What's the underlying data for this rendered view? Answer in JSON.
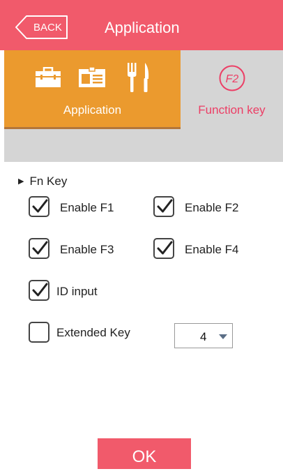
{
  "header": {
    "back_label": "BACK",
    "title": "Application"
  },
  "tabs": [
    {
      "label": "Application",
      "icons": [
        "briefcase-icon",
        "id-card-icon",
        "fork-knife-icon"
      ],
      "active": true
    },
    {
      "label": "Function key",
      "icon_text": "F2",
      "active": false
    }
  ],
  "section": {
    "title": "Fn Key"
  },
  "options": [
    {
      "label": "Enable F1",
      "checked": true
    },
    {
      "label": "Enable F2",
      "checked": true
    },
    {
      "label": "Enable F3",
      "checked": true
    },
    {
      "label": "Enable F4",
      "checked": true
    },
    {
      "label": "ID input",
      "checked": true
    },
    {
      "label": "Extended Key",
      "checked": false
    }
  ],
  "extended_key_select": {
    "value": "4"
  },
  "footer": {
    "ok_label": "OK"
  },
  "colors": {
    "header": "#f15a6b",
    "tab_active": "#eb9a2e",
    "tab_inactive": "#d5d5d5",
    "tab_fn_text": "#ec3e65"
  }
}
